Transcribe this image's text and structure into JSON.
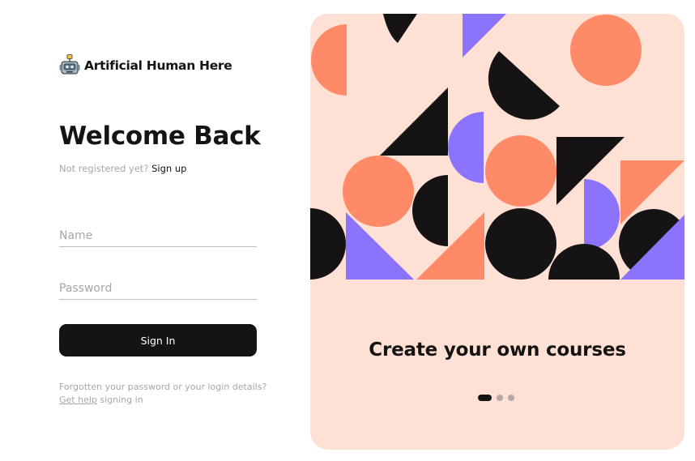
{
  "brand": {
    "name": "Artificial Human Here",
    "logo_icon": "robot-icon"
  },
  "login": {
    "title": "Welcome Back",
    "not_registered": "Not registered yet?",
    "signup_link": "Sign up",
    "name_placeholder": "Name",
    "password_placeholder": "Password",
    "signin_label": "Sign In",
    "help_text": "Forgotten your password or your login details?",
    "help_link": "Get help",
    "help_suffix": "signing in"
  },
  "carousel": {
    "caption": "Create your own courses",
    "slide_count": 3,
    "active_slide": 1
  },
  "colors": {
    "dark": "#151313",
    "coral": "#ff8a68",
    "purple": "#8b73fc",
    "peach": "#ffe0d4",
    "muted_text": "#a7a7a7"
  }
}
